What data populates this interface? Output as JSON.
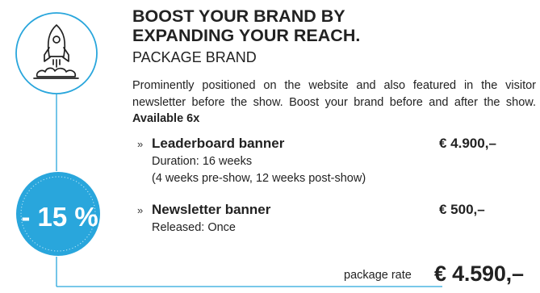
{
  "title": {
    "line1": "BOOST YOUR BRAND BY",
    "line2": "EXPANDING YOUR REACH."
  },
  "subtitle": "PACKAGE BRAND",
  "description": {
    "text": "Prominently positioned on the website and also featured in the visitor newsletter before the show. Boost your brand before and after the show. ",
    "availability": "Available 6x"
  },
  "items": [
    {
      "marker": "»",
      "name": "Leaderboard banner",
      "price": "€ 4.900,–",
      "details": [
        "Duration: 16 weeks",
        "(4 weeks pre-show, 12 weeks post-show)"
      ]
    },
    {
      "marker": "»",
      "name": "Newsletter banner",
      "price": "€ 500,–",
      "details": [
        "Released: Once"
      ]
    }
  ],
  "discount": "- 15 %",
  "package": {
    "label": "package rate",
    "price": "€ 4.590,–"
  },
  "icon": "rocket-icon",
  "colors": {
    "accent": "#29a6dc",
    "accent_light": "#8fd0ef",
    "text": "#222222"
  }
}
